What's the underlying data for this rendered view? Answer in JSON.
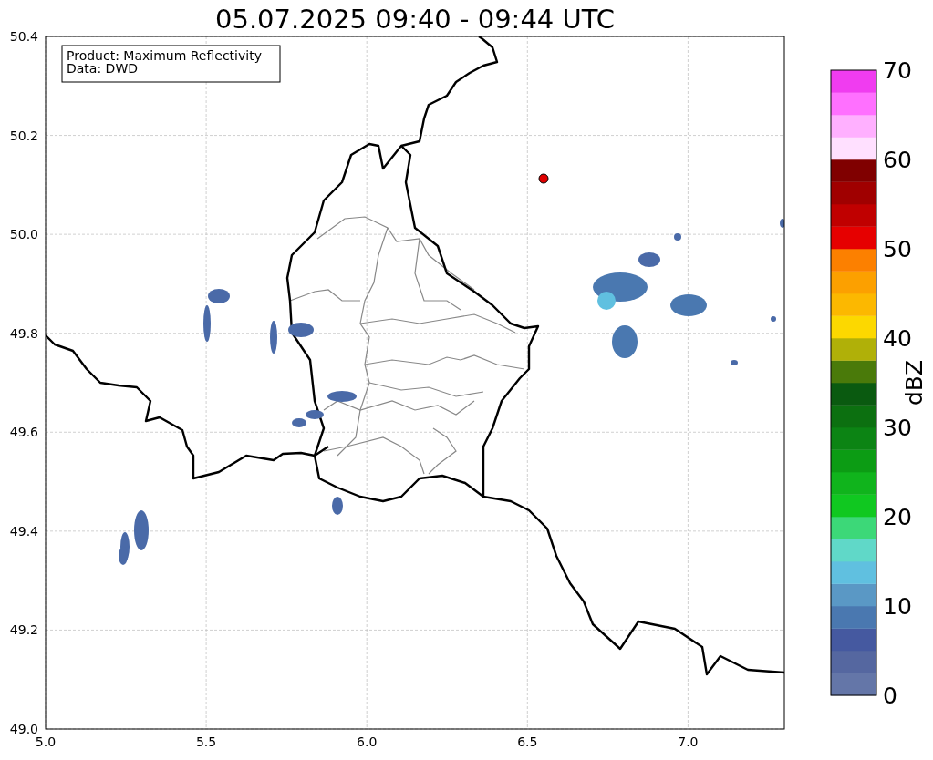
{
  "title": "05.07.2025 09:40 - 09:44 UTC",
  "map": {
    "legend_lines": [
      "Product: Maximum Reflectivity",
      "Data: DWD"
    ],
    "xticks": [
      "5.0",
      "5.5",
      "6.0",
      "6.5",
      "7.0"
    ],
    "yticks": [
      "50.4",
      "50.2",
      "50.0",
      "49.8",
      "49.6",
      "49.4",
      "49.2",
      "49.0"
    ]
  },
  "colorbar": {
    "label": "dBZ",
    "ticks": [
      "70",
      "60",
      "50",
      "40",
      "30",
      "20",
      "10",
      "0"
    ],
    "segments": [
      {
        "color": "#6476a8"
      },
      {
        "color": "#5567a0"
      },
      {
        "color": "#4559a0"
      },
      {
        "color": "#4a78b0"
      },
      {
        "color": "#5a98c5"
      },
      {
        "color": "#60c0e0"
      },
      {
        "color": "#60d8c8"
      },
      {
        "color": "#3cd878"
      },
      {
        "color": "#10c820"
      },
      {
        "color": "#10b41c"
      },
      {
        "color": "#0c9c14"
      },
      {
        "color": "#0c8414"
      },
      {
        "color": "#0c7010"
      },
      {
        "color": "#0a5a10"
      },
      {
        "color": "#4a7a0a"
      },
      {
        "color": "#b0b008"
      },
      {
        "color": "#fcd800"
      },
      {
        "color": "#fcb800"
      },
      {
        "color": "#fca000"
      },
      {
        "color": "#fc8000"
      },
      {
        "color": "#e60000"
      },
      {
        "color": "#c00000"
      },
      {
        "color": "#a00000"
      },
      {
        "color": "#800000"
      },
      {
        "color": "#ffe0ff"
      },
      {
        "color": "#ffb0ff"
      },
      {
        "color": "#ff70ff"
      },
      {
        "color": "#f03cf0"
      }
    ]
  }
}
